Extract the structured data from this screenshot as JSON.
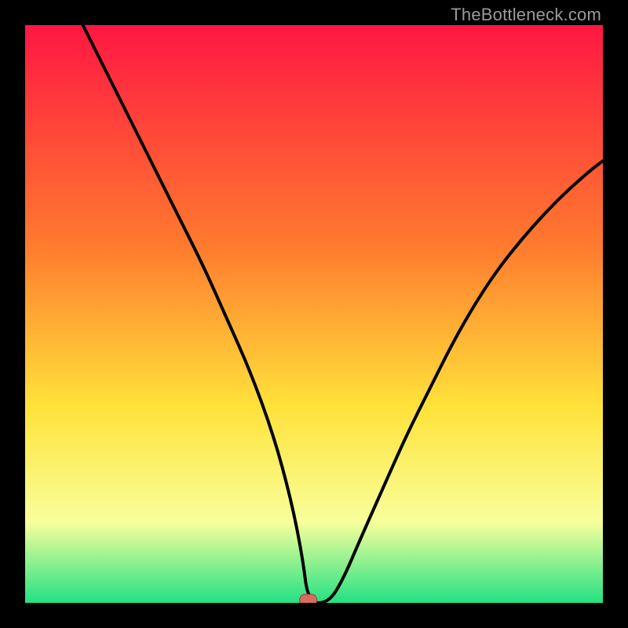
{
  "watermark": "TheBottleneck.com",
  "colors": {
    "black": "#000000",
    "line": "#000000",
    "marker_fill": "#d86b63",
    "marker_stroke": "#9a3f36",
    "gradient": {
      "top": "#ff1743",
      "mid_upper": "#ff7a2e",
      "mid": "#ffe23a",
      "mid_lower": "#f8ff9b",
      "bottom": "#23e183"
    }
  },
  "chart_data": {
    "type": "line",
    "title": "",
    "xlabel": "",
    "ylabel": "",
    "xlim": [
      0,
      100
    ],
    "ylim": [
      0,
      100
    ],
    "grid": false,
    "marker": {
      "x": 49,
      "y": 0
    },
    "series": [
      {
        "name": "curve",
        "x": [
          10,
          15,
          20,
          23,
          27,
          31,
          35,
          39,
          43,
          46,
          48,
          49,
          52.5,
          55,
          58,
          62,
          66,
          70,
          74,
          78,
          82,
          86,
          90,
          94,
          98,
          100
        ],
        "y": [
          100,
          90,
          80,
          74,
          66,
          58,
          49,
          40,
          29,
          18,
          8,
          0,
          0,
          4,
          11,
          20,
          29,
          37,
          45,
          52,
          58,
          63,
          67.5,
          71.5,
          75,
          76.5
        ]
      }
    ]
  }
}
